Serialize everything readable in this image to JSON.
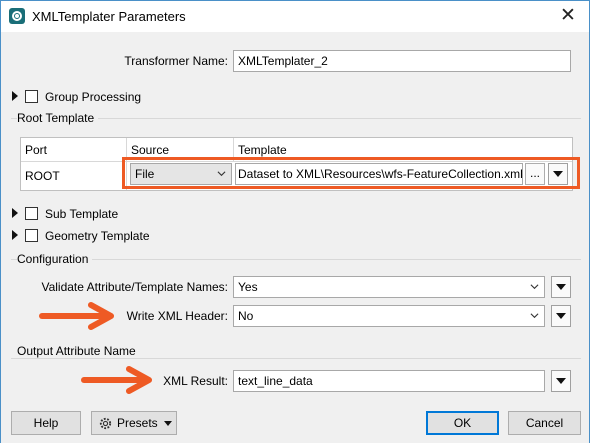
{
  "window": {
    "title": "XMLTemplater Parameters",
    "close_glyph": "✕"
  },
  "transformer_name": {
    "label": "Transformer Name:",
    "value": "XMLTemplater_2"
  },
  "group_processing": {
    "label": "Group Processing",
    "checked": false
  },
  "root_template": {
    "section_title": "Root Template",
    "columns": [
      "Port",
      "Source",
      "Template"
    ],
    "row": {
      "port": "ROOT",
      "source": "File",
      "template": "Dataset to XML\\Resources\\wfs-FeatureCollection.xml\"",
      "browse": "..."
    }
  },
  "sub_template": {
    "label": "Sub Template",
    "checked": false
  },
  "geometry_template": {
    "label": "Geometry Template",
    "checked": false
  },
  "configuration": {
    "section_title": "Configuration",
    "validate": {
      "label": "Validate Attribute/Template Names:",
      "value": "Yes"
    },
    "write_header": {
      "label": "Write XML Header:",
      "value": "No"
    }
  },
  "output": {
    "section_title": "Output Attribute Name",
    "xml_result": {
      "label": "XML Result:",
      "value": "text_line_data"
    }
  },
  "buttons": {
    "help": "Help",
    "presets": "Presets",
    "ok": "OK",
    "cancel": "Cancel"
  },
  "colors": {
    "annotation": "#ee5a24",
    "accent": "#0078d7"
  },
  "icons": {
    "app": "xmltemplater-icon",
    "presets": "gear-icon"
  }
}
